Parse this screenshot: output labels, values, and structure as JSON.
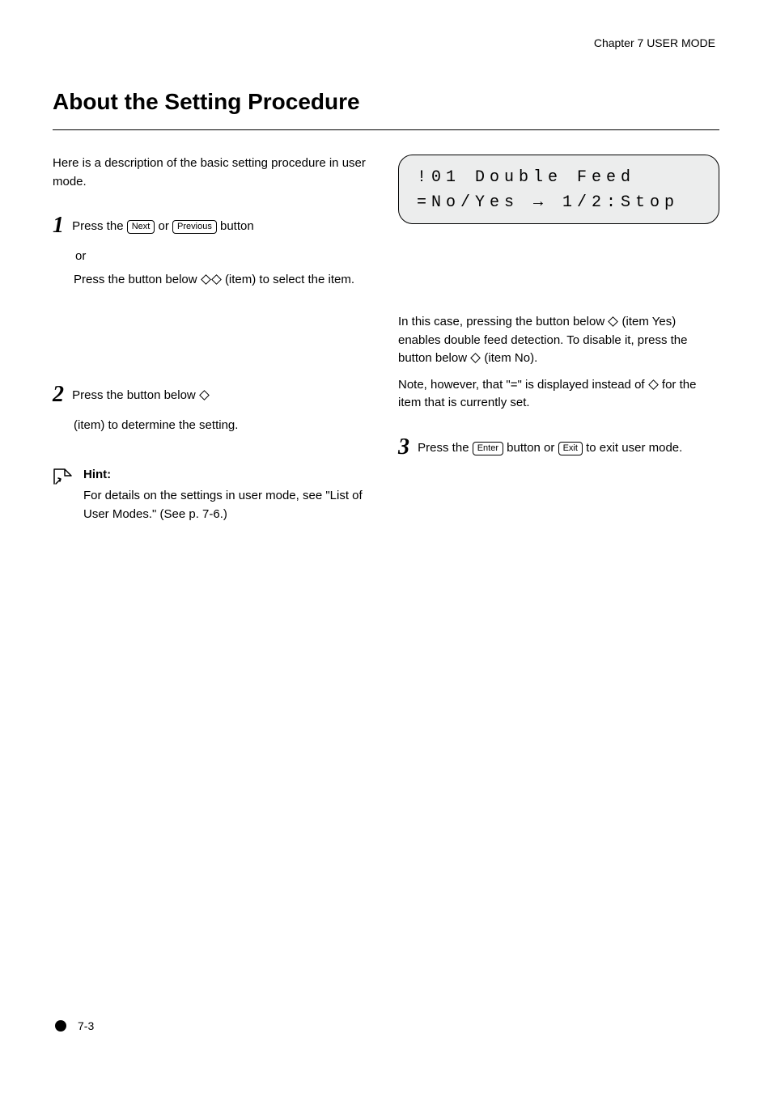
{
  "running_header": "Chapter 7 USER MODE",
  "section_title": "About the Setting Procedure",
  "left": {
    "intro": "Here is a description of the basic setting procedure in user mode.",
    "step1": {
      "line1_before": "Press the ",
      "key1": "Next",
      "line1_mid": " or ",
      "key2": "Previous",
      "line1_after": " button",
      "or": "or",
      "line2_before": "Press the button below ",
      "line2_after": " (item) to select the item."
    },
    "step2": {
      "line1_before": "Press the button below ",
      "line1_after": " (item) to determine the setting."
    },
    "hint_label": "Hint:",
    "hint_text": "For details on the settings in user mode, see \"List of User Modes.\" (See p. 7-6.)"
  },
  "right": {
    "lcd_line1": "!01 Double Feed",
    "lcd_line2": "=No/Yes → 1/2:Stop",
    "r_para1_before": "In this case, pressing the button below ",
    "r_para1_mid": " (item Yes) enables double feed detection. To disable it, press the button below ",
    "r_para1_after": " (item No).",
    "r_para2_before": "Note, however, that \"=\" is displayed instead of ",
    "r_para2_after": " for the item that is currently set.",
    "step3": {
      "line1_before": "Press the ",
      "key1": "Enter",
      "line1_mid": " button or ",
      "key2": "Exit",
      "line1_after": " to exit user mode."
    }
  },
  "page_number": "7-3"
}
